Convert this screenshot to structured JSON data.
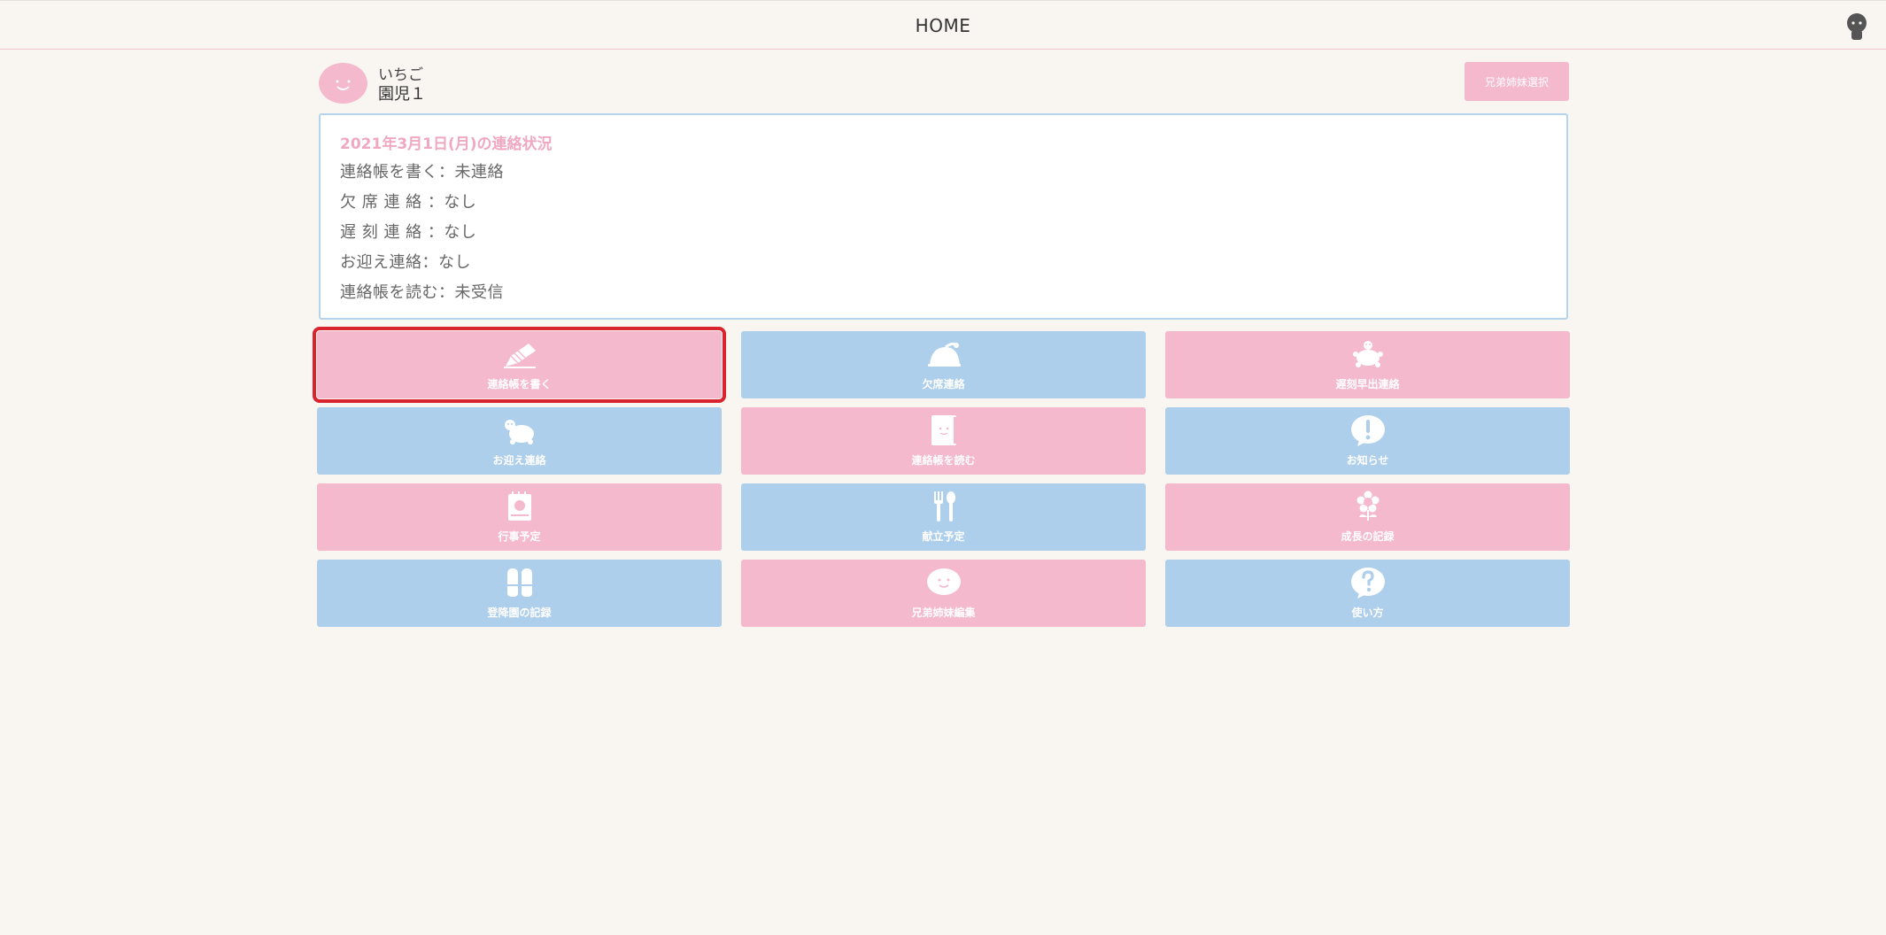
{
  "header": {
    "title": "HOME",
    "user_icon": "user-icon"
  },
  "profile": {
    "name": "いちご",
    "class": "園児１",
    "sibling_button": "兄弟姉妹選択"
  },
  "status": {
    "title": "2021年3月1日(月)の連絡状況",
    "rows": [
      "連絡帳を書く：未連絡",
      "欠 席 連 絡 ：なし",
      "遅 刻 連 絡 ：なし",
      "お迎え連絡：なし",
      "連絡帳を読む：未受信"
    ]
  },
  "tiles": [
    {
      "label": "連絡帳を書く",
      "icon": "pencil-icon",
      "color": "#f4b9cc"
    },
    {
      "label": "欠席連絡",
      "icon": "sleeping-turtle-icon",
      "color": "#aecfeb"
    },
    {
      "label": "遅刻早出連絡",
      "icon": "turtle-icon",
      "color": "#f4b9cc"
    },
    {
      "label": "お迎え連絡",
      "icon": "turtle-icon",
      "color": "#aecfeb"
    },
    {
      "label": "連絡帳を読む",
      "icon": "notebook-icon",
      "color": "#f4b9cc"
    },
    {
      "label": "お知らせ",
      "icon": "exclamation-icon",
      "color": "#aecfeb"
    },
    {
      "label": "行事予定",
      "icon": "calendar-icon",
      "color": "#f4b9cc"
    },
    {
      "label": "献立予定",
      "icon": "fork-spoon-icon",
      "color": "#aecfeb"
    },
    {
      "label": "成長の記録",
      "icon": "flower-icon",
      "color": "#f4b9cc"
    },
    {
      "label": "登降園の記録",
      "icon": "shoes-icon",
      "color": "#aecfeb"
    },
    {
      "label": "兄弟姉妹編集",
      "icon": "face-bubble-icon",
      "color": "#f4b9cc"
    },
    {
      "label": "使い方",
      "icon": "question-icon",
      "color": "#aecfeb"
    }
  ],
  "colors": {
    "pink": "#f4b9cc",
    "blue": "#aecfeb",
    "selection": "#d9232e"
  }
}
